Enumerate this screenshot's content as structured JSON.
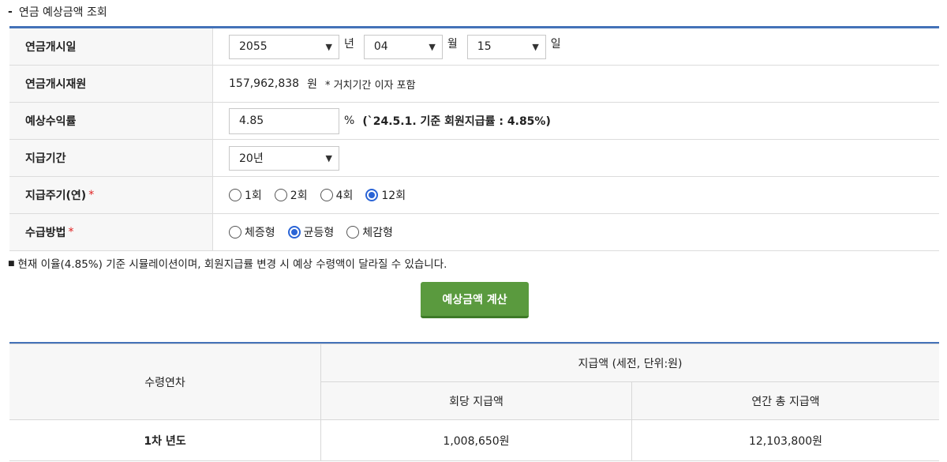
{
  "section_title": "연금 예상금액 조회",
  "form": {
    "start_date": {
      "label": "연금개시일",
      "year": "2055",
      "year_unit": "년",
      "month": "04",
      "month_unit": "월",
      "day": "15",
      "day_unit": "일"
    },
    "principal": {
      "label": "연금개시재원",
      "amount": "157,962,838",
      "unit": "원",
      "note": "* 거치기간 이자 포함"
    },
    "rate": {
      "label": "예상수익률",
      "value": "4.85",
      "unit": "%",
      "note": "(`24.5.1. 기준 회원지급률 : 4.85%)"
    },
    "period": {
      "label": "지급기간",
      "value": "20년"
    },
    "cycle": {
      "label": "지급주기(연)",
      "required": "*",
      "options": [
        "1회",
        "2회",
        "4회",
        "12회"
      ],
      "selected": "12회"
    },
    "method": {
      "label": "수급방법",
      "required": "*",
      "options": [
        "체증형",
        "균등형",
        "체감형"
      ],
      "selected": "균등형"
    }
  },
  "notice": "현재 이율(4.85%) 기준 시뮬레이션이며, 회원지급률 변경 시 예상 수령액이 달라질 수 있습니다.",
  "calc_button": "예상금액 계산",
  "result": {
    "col_year": "수령연차",
    "col_group": "지급액 (세전, 단위:원)",
    "col_per": "회당 지급액",
    "col_annual": "연간 총 지급액",
    "rows": [
      {
        "year": "1차 년도",
        "per": "1,008,650원",
        "annual": "12,103,800원"
      }
    ]
  }
}
